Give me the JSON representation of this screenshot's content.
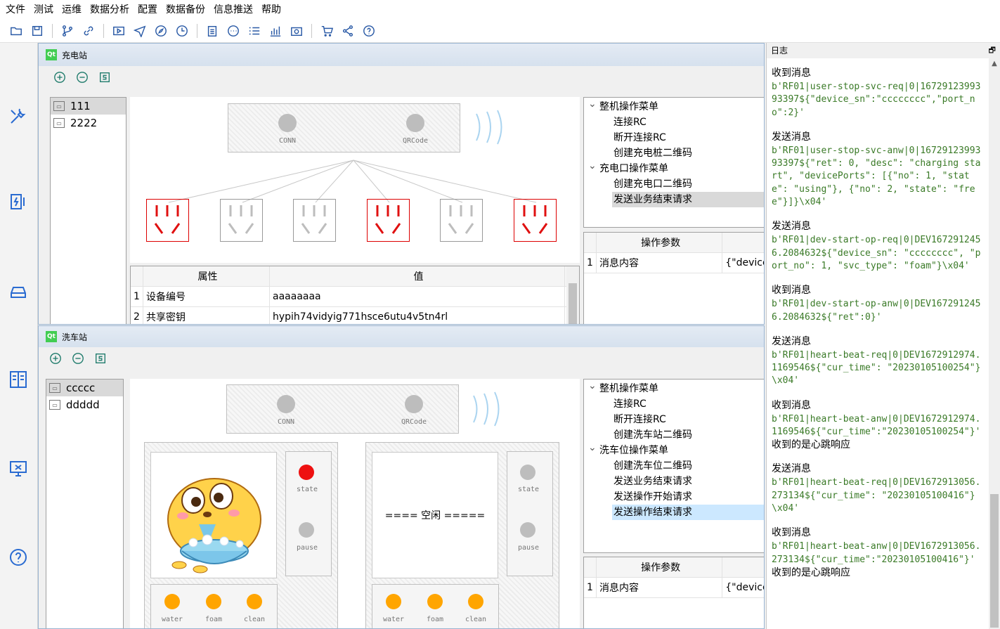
{
  "menu": [
    "文件",
    "测试",
    "运维",
    "数据分析",
    "配置",
    "数据备份",
    "信息推送",
    "帮助"
  ],
  "toolbar_icons": [
    "open-folder-icon",
    "save-icon",
    "branch-icon",
    "link-icon",
    "play-icon",
    "send-icon",
    "compass-icon",
    "clock-icon",
    "clipboard-icon",
    "chat-icon",
    "list-icon",
    "bar-chart-icon",
    "camera-icon",
    "cart-icon",
    "share-icon",
    "help-icon"
  ],
  "sidebar_icons": [
    "tools-icon",
    "charger-icon",
    "car-icon",
    "panel-icon",
    "monitor-icon",
    "help-circle-icon"
  ],
  "charging": {
    "title": "充电站",
    "devices": [
      "111",
      "2222"
    ],
    "conn_label": "CONN",
    "qr_label": "QRCode",
    "ports_on": [
      true,
      false,
      false,
      true,
      false,
      true
    ],
    "tree": [
      {
        "label": "整机操作菜单",
        "children": [
          "连接RC",
          "断开连接RC",
          "创建充电桩二维码"
        ]
      },
      {
        "label": "充电口操作菜单",
        "children": [
          "创建充电口二维码",
          "发送业务结束请求"
        ]
      }
    ],
    "props": {
      "headers": [
        "属性",
        "值"
      ],
      "rows": [
        {
          "n": "1",
          "k": "设备编号",
          "v": "aaaaaaaa"
        },
        {
          "n": "2",
          "k": "共享密钥",
          "v": "hypih74vidyig771hsce6utu4v5tn4rl"
        }
      ]
    },
    "params": {
      "headers": [
        "操作参数",
        ""
      ],
      "rows": [
        {
          "n": "1",
          "k": "消息内容",
          "v": "{\"device"
        }
      ]
    }
  },
  "wash": {
    "title": "洗车站",
    "devices": [
      "ccccc",
      "ddddd"
    ],
    "conn_label": "CONN",
    "qr_label": "QRCode",
    "bay1": {
      "state": "state",
      "pause": "pause",
      "water": "water",
      "foam": "foam",
      "clean": "clean"
    },
    "bay2": {
      "idle": "==== 空闲 =====",
      "state": "state",
      "pause": "pause",
      "water": "water",
      "foam": "foam",
      "clean": "clean"
    },
    "tree": [
      {
        "label": "整机操作菜单",
        "children": [
          "连接RC",
          "断开连接RC",
          "创建洗车站二维码"
        ]
      },
      {
        "label": "洗车位操作菜单",
        "children": [
          "创建洗车位二维码",
          "发送业务结束请求",
          "发送操作开始请求",
          "发送操作结束请求"
        ]
      }
    ],
    "params": {
      "headers": [
        "操作参数",
        ""
      ],
      "rows": [
        {
          "n": "1",
          "k": "消息内容",
          "v": "{\"device"
        }
      ]
    }
  },
  "log": {
    "title": "日志",
    "float_btn": "🗗",
    "entries": [
      {
        "type": "收到消息",
        "msg": "b'RF01|user-stop-svc-req|0|1672912399393397${\"device_sn\":\"cccccccc\",\"port_no\":2}'"
      },
      {
        "type": "发送消息",
        "msg": "b'RF01|user-stop-svc-anw|0|1672912399393397${\"ret\": 0, \"desc\": \"charging start\", \"devicePorts\": [{\"no\": 1, \"state\": \"using\"}, {\"no\": 2, \"state\": \"free\"}]}\\x04'"
      },
      {
        "type": "发送消息",
        "msg": "b'RF01|dev-start-op-req|0|DEV1672912456.2084632${\"device_sn\": \"cccccccc\", \"port_no\": 1, \"svc_type\": \"foam\"}\\x04'"
      },
      {
        "type": "收到消息",
        "msg": "b'RF01|dev-start-op-anw|0|DEV1672912456.2084632${\"ret\":0}'"
      },
      {
        "type": "发送消息",
        "msg": "b'RF01|heart-beat-req|0|DEV1672912974.1169546${\"cur_time\": \"20230105100254\"}\\x04'"
      },
      {
        "type": "收到消息",
        "msg": "b'RF01|heart-beat-anw|0|DEV1672912974.1169546${\"cur_time\":\"20230105100254\"}'",
        "note": "收到的是心跳响应"
      },
      {
        "type": "发送消息",
        "msg": "b'RF01|heart-beat-req|0|DEV1672913056.273134${\"cur_time\": \"20230105100416\"}\\x04'"
      },
      {
        "type": "收到消息",
        "msg": "b'RF01|heart-beat-anw|0|DEV1672913056.273134${\"cur_time\":\"20230105100416\"}'",
        "note": "收到的是心跳响应"
      }
    ]
  }
}
